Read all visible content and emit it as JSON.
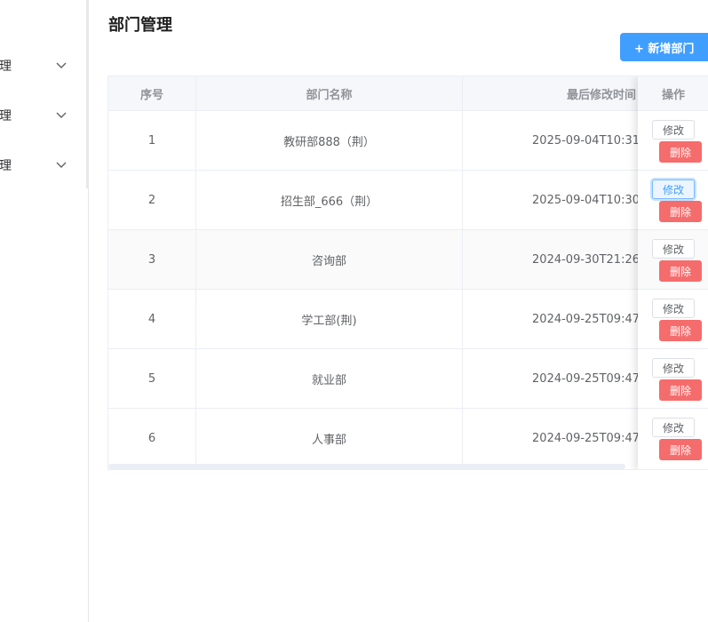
{
  "sidebar": {
    "items": [
      {
        "label": "理",
        "icon": "chevron-down-icon"
      },
      {
        "label": "理",
        "icon": "chevron-down-icon"
      },
      {
        "label": "理",
        "icon": "chevron-down-icon"
      }
    ]
  },
  "page": {
    "title": "部门管理",
    "add_button_label": "+ 新增部门"
  },
  "table": {
    "headers": {
      "index": "序号",
      "name": "部门名称",
      "updated": "最后修改时间",
      "actions": "操作"
    },
    "edit_label": "修改",
    "delete_label": "删除",
    "rows": [
      {
        "index": "1",
        "name": "教研部888（荆）",
        "updated": "2025-09-04T10:31"
      },
      {
        "index": "2",
        "name": "招生部_666（荆）",
        "updated": "2025-09-04T10:30"
      },
      {
        "index": "3",
        "name": "咨询部",
        "updated": "2024-09-30T21:26"
      },
      {
        "index": "4",
        "name": "学工部(荆)",
        "updated": "2024-09-25T09:47"
      },
      {
        "index": "5",
        "name": "就业部",
        "updated": "2024-09-25T09:47"
      },
      {
        "index": "6",
        "name": "人事部",
        "updated": "2024-09-25T09:47"
      }
    ]
  },
  "colors": {
    "primary": "#409eff",
    "danger": "#f56c6c",
    "header_bg": "#f5f7fa",
    "border": "#ebeef5"
  }
}
